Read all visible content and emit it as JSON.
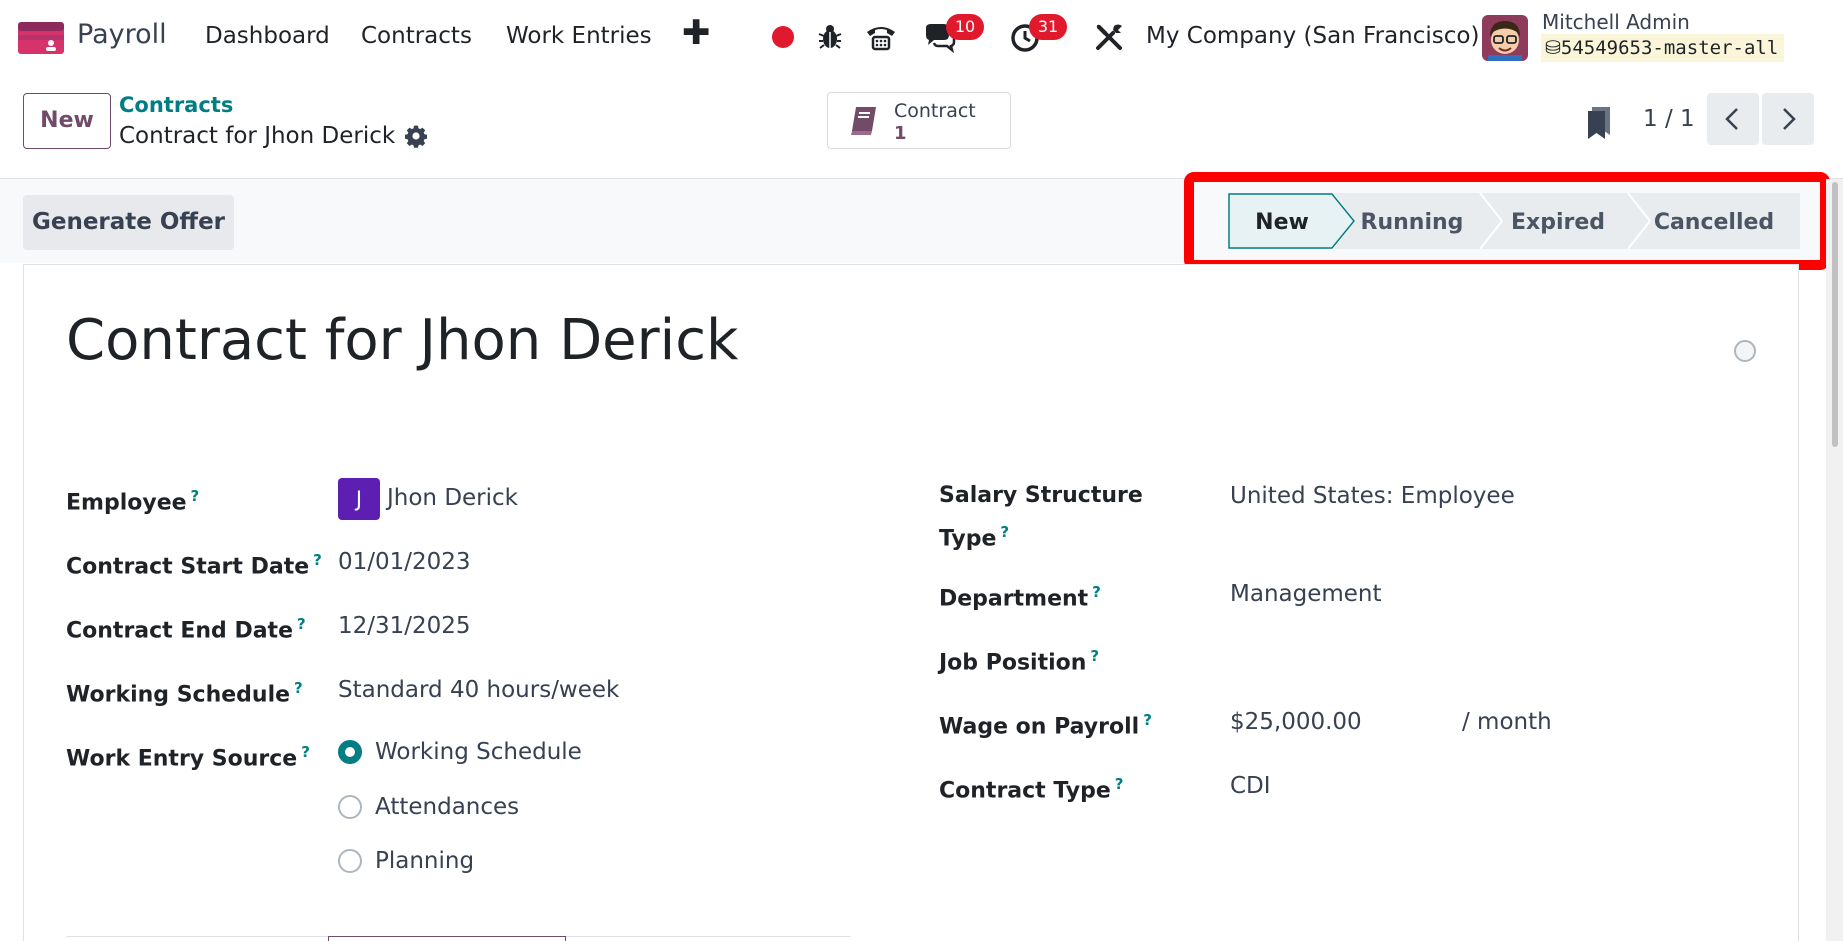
{
  "navbar": {
    "app_name": "Payroll",
    "menu": [
      "Dashboard",
      "Contracts",
      "Work Entries"
    ],
    "plus_label": "✚",
    "messages_count": "10",
    "activities_count": "31",
    "company": "My Company (San Francisco)",
    "user_name": "Mitchell Admin",
    "database": "54549653-master-all"
  },
  "control_panel": {
    "new_label": "New",
    "breadcrumb_parent": "Contracts",
    "breadcrumb_current": "Contract for Jhon Derick",
    "smart_button": {
      "label": "Contract",
      "value": "1"
    },
    "pager": "1 / 1"
  },
  "statusbar": {
    "generate_offer_label": "Generate Offer",
    "stages": [
      "New",
      "Running",
      "Expired",
      "Cancelled"
    ],
    "active_stage": "New"
  },
  "form": {
    "title": "Contract for Jhon Derick",
    "help_mark": "?",
    "left": {
      "employee_label": "Employee",
      "employee_initial": "J",
      "employee_value": "Jhon Derick",
      "start_date_label": "Contract Start Date",
      "start_date_value": "01/01/2023",
      "end_date_label": "Contract End Date",
      "end_date_value": "12/31/2025",
      "schedule_label": "Working Schedule",
      "schedule_value": "Standard 40 hours/week",
      "work_entry_label": "Work Entry Source",
      "work_entry_options": [
        "Working Schedule",
        "Attendances",
        "Planning"
      ],
      "work_entry_selected": "Working Schedule"
    },
    "right": {
      "salary_structure_label_1": "Salary Structure",
      "salary_structure_label_2": "Type",
      "salary_structure_value": "United States: Employee",
      "department_label": "Department",
      "department_value": "Management",
      "job_position_label": "Job Position",
      "job_position_value": "",
      "wage_label": "Wage on Payroll",
      "wage_value": "$25,000.00",
      "wage_period": "/ month",
      "contract_type_label": "Contract Type",
      "contract_type_value": "CDI"
    }
  },
  "colors": {
    "brand": "#714b67",
    "accent": "#017e84",
    "badge": "#e0192c",
    "highlight": "#ff0000",
    "active_stage_bg": "#e6f2f3"
  }
}
